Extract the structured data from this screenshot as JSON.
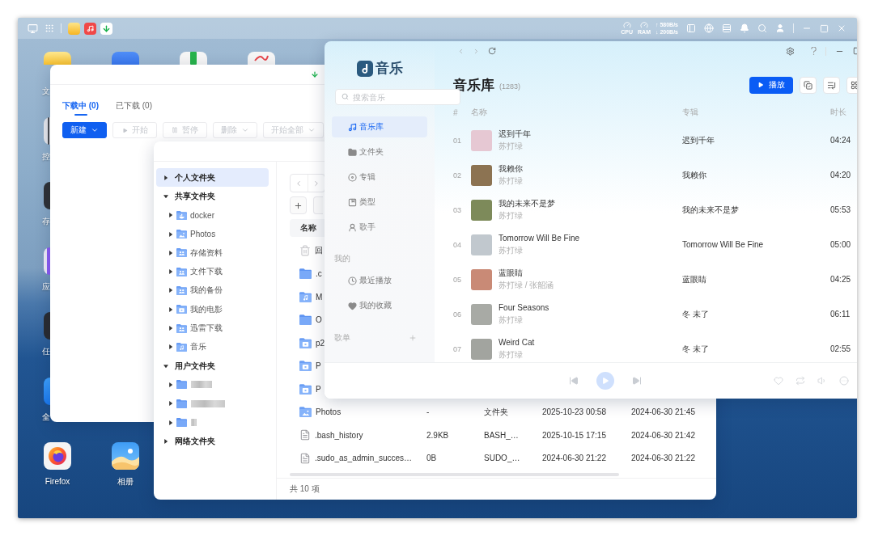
{
  "top_bar": {
    "cpu_label": "CPU",
    "ram_label": "RAM",
    "upload_speed": "↑ 580B/s",
    "download_speed": "↓ 200B/s"
  },
  "desktop_icons": [
    {
      "kind": "files",
      "label": "文"
    },
    {
      "kind": "vm"
    },
    {
      "kind": "sheet"
    },
    {
      "kind": "chart"
    },
    {
      "kind": "control",
      "label": "控"
    },
    {
      "kind": "storage",
      "label": "存"
    },
    {
      "kind": "apps",
      "label": "应"
    },
    {
      "kind": "tasks",
      "label": "任"
    },
    {
      "kind": "web",
      "label": "全"
    },
    {
      "kind": "firefox",
      "label": "Firefox"
    },
    {
      "kind": "photos",
      "label": "相册"
    }
  ],
  "download_window": {
    "tabs": [
      {
        "label": "下载中 (0)",
        "selected": true
      },
      {
        "label": "已下载 (0)",
        "selected": false
      }
    ],
    "buttons": [
      {
        "label": "新建",
        "kind": "menu",
        "primary": true,
        "disabled": false
      },
      {
        "label": "开始",
        "kind": "play",
        "primary": false,
        "disabled": true
      },
      {
        "label": "暂停",
        "kind": "pause",
        "primary": false,
        "disabled": true
      },
      {
        "label": "删除",
        "kind": "menu",
        "primary": false,
        "disabled": true
      },
      {
        "label": "开始全部",
        "kind": "menu",
        "primary": false,
        "disabled": true
      }
    ]
  },
  "file_manager": {
    "tree": [
      {
        "label": "个人文件夹",
        "selected": true,
        "expanded": false
      },
      {
        "label": "共享文件夹",
        "selected": false,
        "expanded": true,
        "children": [
          {
            "label": "docker",
            "kind": "docker",
            "selected": false,
            "expanded": false
          },
          {
            "label": "Photos",
            "kind": "photos",
            "selected": false,
            "expanded": false
          },
          {
            "label": "存储资料",
            "kind": "shared",
            "selected": false,
            "expanded": false
          },
          {
            "label": "文件下载",
            "kind": "shared",
            "selected": false,
            "expanded": false
          },
          {
            "label": "我的备份",
            "kind": "shared",
            "selected": false,
            "expanded": false
          },
          {
            "label": "我的电影",
            "kind": "video",
            "selected": false,
            "expanded": false
          },
          {
            "label": "迅雷下载",
            "kind": "shared",
            "selected": false,
            "expanded": false
          },
          {
            "label": "音乐",
            "kind": "music",
            "selected": false,
            "expanded": false
          }
        ]
      },
      {
        "label": "用户文件夹",
        "selected": false,
        "expanded": true,
        "children": [
          {
            "kind": "user",
            "blurred": true,
            "selected": false,
            "expanded": false
          },
          {
            "kind": "user",
            "blurred": true,
            "selected": false,
            "expanded": false
          },
          {
            "kind": "user",
            "blurred": true,
            "selected": false,
            "expanded": false
          }
        ]
      },
      {
        "label": "网络文件夹",
        "selected": false,
        "expanded": false
      }
    ],
    "columns": [
      "名称"
    ],
    "files": [
      {
        "kind": "recycle",
        "name": "回"
      },
      {
        "kind": "folder",
        "name": ".c"
      },
      {
        "kind": "music",
        "name": "M"
      },
      {
        "kind": "folder",
        "name": "O"
      },
      {
        "kind": "app",
        "name": "p2"
      },
      {
        "kind": "app",
        "name": "P"
      },
      {
        "kind": "app",
        "name": "P"
      },
      {
        "kind": "photos",
        "name": "Photos",
        "size": "-",
        "type": "文件夹",
        "modified": "2025-10-23 00:58",
        "created": "2024-06-30 21:45"
      },
      {
        "kind": "file",
        "name": ".bash_history",
        "size": "2.9KB",
        "type": "BASH_…",
        "modified": "2025-10-15 17:15",
        "created": "2024-06-30 21:42"
      },
      {
        "kind": "file",
        "name": ".sudo_as_admin_succes…",
        "size": "0B",
        "type": "SUDO_…",
        "modified": "2024-06-30 21:22",
        "created": "2024-06-30 21:22"
      }
    ],
    "footer": "共 10 项"
  },
  "music_window": {
    "app_name": "音乐",
    "search": {
      "placeholder": "搜索音乐"
    },
    "nav": [
      {
        "kind": "library",
        "label": "音乐库",
        "selected": true
      },
      {
        "kind": "folder",
        "label": "文件夹",
        "selected": false
      },
      {
        "kind": "album",
        "label": "专辑",
        "selected": false
      },
      {
        "kind": "genre",
        "label": "类型",
        "selected": false
      },
      {
        "kind": "artist",
        "label": "歌手",
        "selected": false
      }
    ],
    "my_title": "我的",
    "my_items": [
      {
        "kind": "recent",
        "label": "最近播放",
        "selected": false
      },
      {
        "kind": "favorites",
        "label": "我的收藏",
        "selected": false
      }
    ],
    "playlists_title": "歌单",
    "title": "音乐库",
    "count": "(1283)",
    "play_button": "播放",
    "columns": [
      "#",
      "名称",
      "专辑",
      "时长"
    ],
    "tracks": [
      {
        "number": "01",
        "title": "迟到千年",
        "artist": "苏打绿",
        "album": "迟到千年",
        "duration": "04:24"
      },
      {
        "number": "02",
        "title": "我赖你",
        "artist": "苏打绿",
        "album": "我赖你",
        "duration": "04:20"
      },
      {
        "number": "03",
        "title": "我的未来不是梦",
        "artist": "苏打绿",
        "album": "我的未来不是梦",
        "duration": "05:53"
      },
      {
        "number": "04",
        "title": "Tomorrow Will Be Fine",
        "artist": "苏打绿",
        "album": "Tomorrow Will Be Fine",
        "duration": "05:00"
      },
      {
        "number": "05",
        "title": "蓝眼睛",
        "artist": "苏打绿 / 张韶涵",
        "album": "蓝眼睛",
        "duration": "04:25"
      },
      {
        "number": "06",
        "title": "Four Seasons",
        "artist": "苏打绿",
        "album": "冬 未了",
        "duration": "06:11"
      },
      {
        "number": "07",
        "title": "Weird Cat",
        "artist": "苏打绿",
        "album": "冬 未了",
        "duration": "02:55"
      }
    ]
  }
}
